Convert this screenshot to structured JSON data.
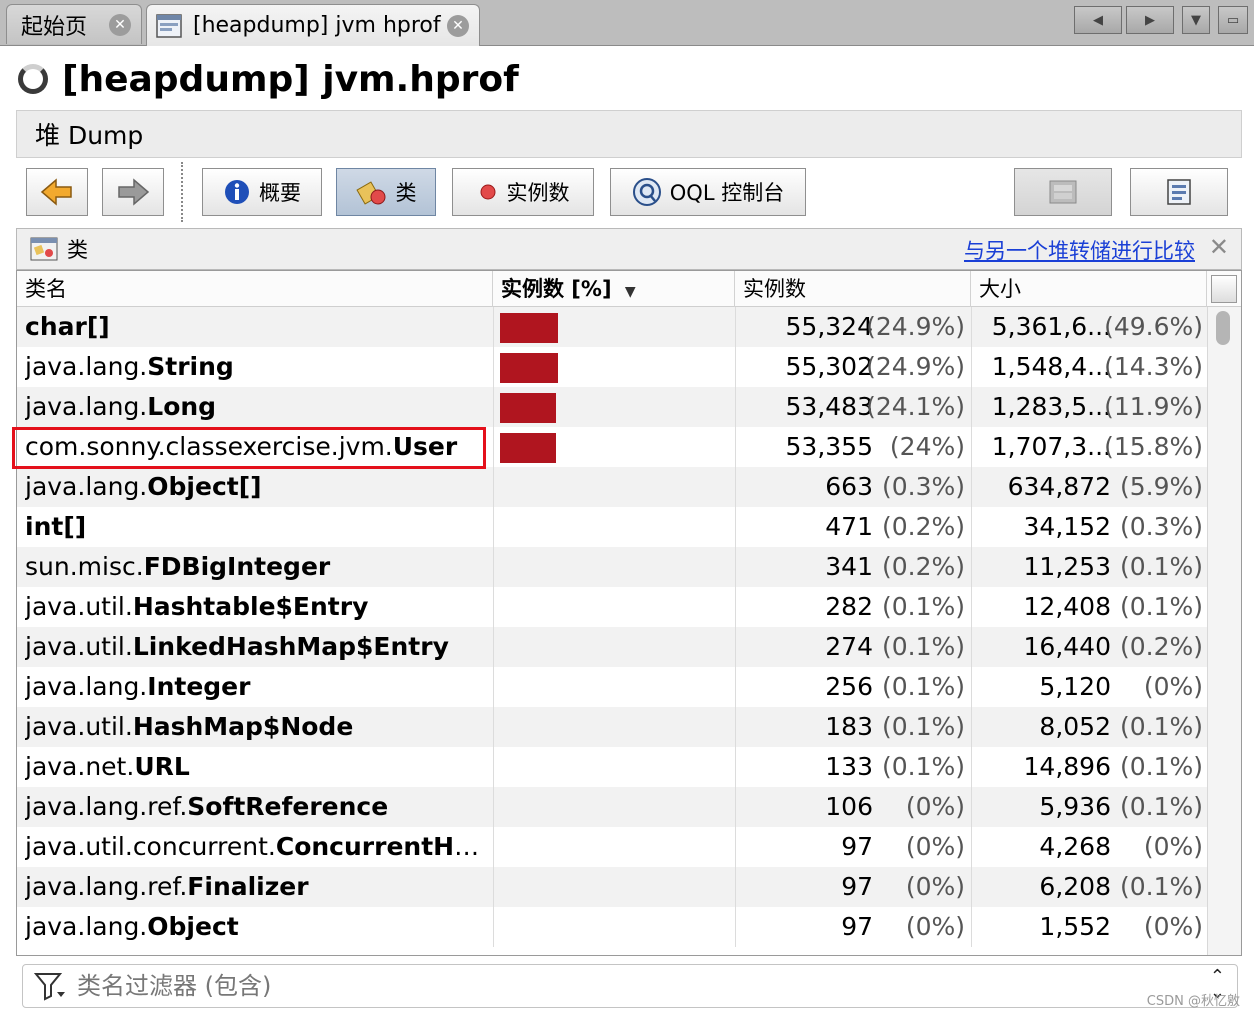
{
  "tabs": [
    {
      "label": "起始页"
    },
    {
      "label": "[heapdump] jvm hprof"
    }
  ],
  "title": "[heapdump] jvm.hprof",
  "section": "堆 Dump",
  "toolbar": {
    "summary": "概要",
    "classes": "类",
    "instances": "实例数",
    "oql": "OQL 控制台"
  },
  "panel": {
    "title": "类",
    "compare_link": "与另一个堆转储进行比较"
  },
  "table": {
    "headers": {
      "name": "类名",
      "instances_pct": "实例数 [%]",
      "instances": "实例数",
      "size": "大小"
    },
    "rows": [
      {
        "pkg": "",
        "cls": "char[]",
        "count": "55,324",
        "count_pct": "(24.9%)",
        "size": "5,361,6...",
        "size_pct": "(49.6%)",
        "bar": 0.249
      },
      {
        "pkg": "java.lang.",
        "cls": "String",
        "count": "55,302",
        "count_pct": "(24.9%)",
        "size": "1,548,4...",
        "size_pct": "(14.3%)",
        "bar": 0.249
      },
      {
        "pkg": "java.lang.",
        "cls": "Long",
        "count": "53,483",
        "count_pct": "(24.1%)",
        "size": "1,283,5...",
        "size_pct": "(11.9%)",
        "bar": 0.241
      },
      {
        "pkg": "com.sonny.classexercise.jvm.",
        "cls": "User",
        "count": "53,355",
        "count_pct": "(24%)",
        "size": "1,707,3...",
        "size_pct": "(15.8%)",
        "bar": 0.24
      },
      {
        "pkg": "java.lang.",
        "cls": "Object[]",
        "count": "663",
        "count_pct": "(0.3%)",
        "size": "634,872",
        "size_pct": "(5.9%)",
        "bar": 0.003
      },
      {
        "pkg": "",
        "cls": "int[]",
        "count": "471",
        "count_pct": "(0.2%)",
        "size": "34,152",
        "size_pct": "(0.3%)",
        "bar": 0.002
      },
      {
        "pkg": "sun.misc.",
        "cls": "FDBigInteger",
        "count": "341",
        "count_pct": "(0.2%)",
        "size": "11,253",
        "size_pct": "(0.1%)",
        "bar": 0.002
      },
      {
        "pkg": "java.util.",
        "cls": "Hashtable$Entry",
        "count": "282",
        "count_pct": "(0.1%)",
        "size": "12,408",
        "size_pct": "(0.1%)",
        "bar": 0.001
      },
      {
        "pkg": "java.util.",
        "cls": "LinkedHashMap$Entry",
        "count": "274",
        "count_pct": "(0.1%)",
        "size": "16,440",
        "size_pct": "(0.2%)",
        "bar": 0.001
      },
      {
        "pkg": "java.lang.",
        "cls": "Integer",
        "count": "256",
        "count_pct": "(0.1%)",
        "size": "5,120",
        "size_pct": "(0%)",
        "bar": 0.001
      },
      {
        "pkg": "java.util.",
        "cls": "HashMap$Node",
        "count": "183",
        "count_pct": "(0.1%)",
        "size": "8,052",
        "size_pct": "(0.1%)",
        "bar": 0.001
      },
      {
        "pkg": "java.net.",
        "cls": "URL",
        "count": "133",
        "count_pct": "(0.1%)",
        "size": "14,896",
        "size_pct": "(0.1%)",
        "bar": 0.001
      },
      {
        "pkg": "java.lang.ref.",
        "cls": "SoftReference",
        "count": "106",
        "count_pct": "(0%)",
        "size": "5,936",
        "size_pct": "(0.1%)",
        "bar": 0.0
      },
      {
        "pkg": "java.util.concurrent.",
        "cls": "ConcurrentHa...",
        "count": "97",
        "count_pct": "(0%)",
        "size": "4,268",
        "size_pct": "(0%)",
        "bar": 0.0
      },
      {
        "pkg": "java.lang.ref.",
        "cls": "Finalizer",
        "count": "97",
        "count_pct": "(0%)",
        "size": "6,208",
        "size_pct": "(0.1%)",
        "bar": 0.0
      },
      {
        "pkg": "java.lang.",
        "cls": "Object",
        "count": "97",
        "count_pct": "(0%)",
        "size": "1,552",
        "size_pct": "(0%)",
        "bar": 0.0
      }
    ]
  },
  "filter": {
    "placeholder": "类名过滤器 (包含)"
  },
  "watermark": "CSDN @秋忆敫",
  "colors": {
    "bar": "#b0151f",
    "highlight": "#e4101b",
    "link": "#1a3fd6"
  }
}
